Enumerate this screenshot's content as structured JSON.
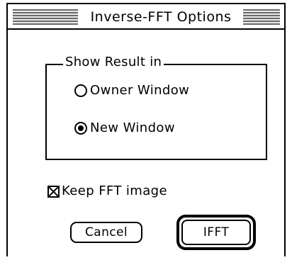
{
  "dialog": {
    "title": "Inverse-FFT Options",
    "group": {
      "label": "Show Result in",
      "options": [
        {
          "label": "Owner Window",
          "selected": false
        },
        {
          "label": "New Window",
          "selected": true
        }
      ]
    },
    "checkbox": {
      "label": "Keep FFT image",
      "checked": true
    },
    "buttons": {
      "cancel_label": "Cancel",
      "ok_label": "IFFT",
      "default": "IFFT"
    }
  }
}
